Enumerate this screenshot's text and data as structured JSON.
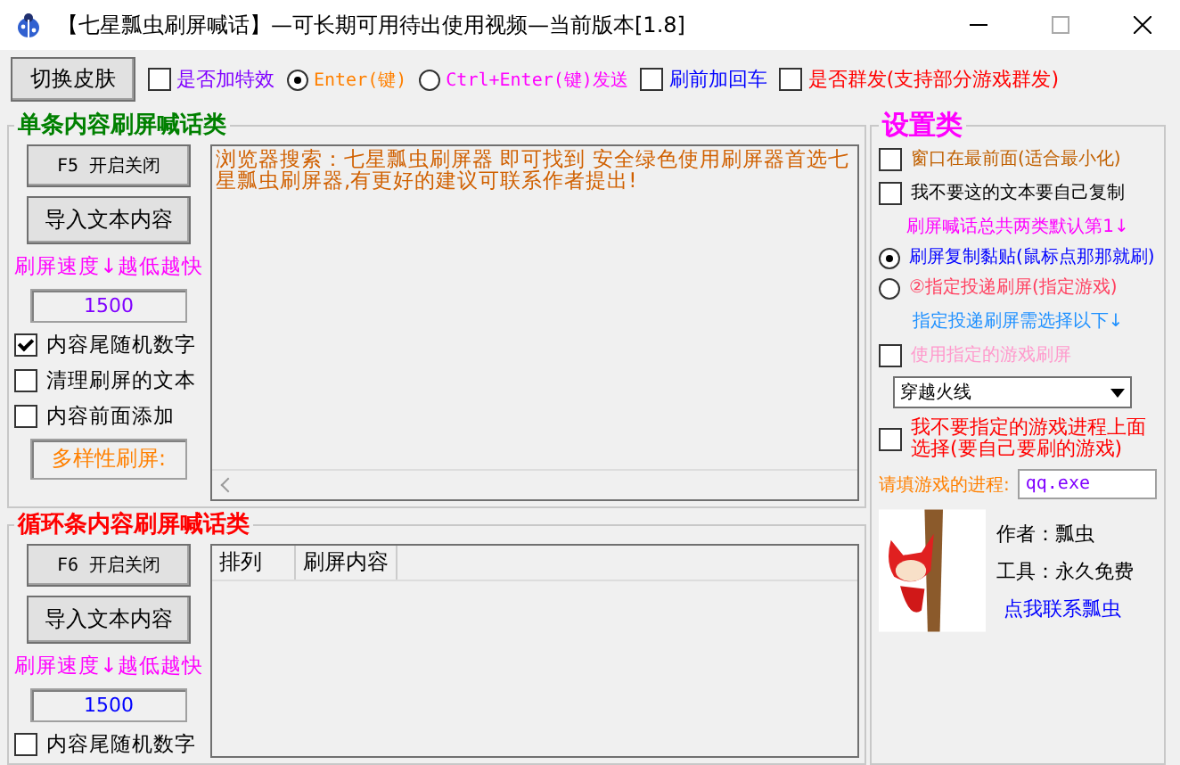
{
  "window": {
    "title": "【七星瓢虫刷屏喊话】—可长期可用待出使用视频—当前版本[1.8]"
  },
  "toolbar": {
    "skin_button": "切换皮肤",
    "options": [
      {
        "kind": "checkbox",
        "label": "是否加特效",
        "checked": false,
        "color": "#8000ff"
      },
      {
        "kind": "radio",
        "label": "Enter(键)",
        "selected": true,
        "color": "#ff8000"
      },
      {
        "kind": "radio",
        "label": "Ctrl+Enter(键)发送",
        "selected": false,
        "color": "#ff00ff"
      },
      {
        "kind": "checkbox",
        "label": "刷前加回车",
        "checked": false,
        "color": "#0000ff"
      },
      {
        "kind": "checkbox",
        "label": "是否群发(支持部分游戏群发)",
        "checked": false,
        "color": "#ff0000"
      }
    ]
  },
  "single_group": {
    "title": "单条内容刷屏喊话类",
    "buttons": [
      "F5 开启关闭",
      "导入文本内容"
    ],
    "speed_label": "刷屏速度↓越低越快",
    "speed_value": "1500",
    "checks": [
      {
        "label": "内容尾随机数字",
        "checked": true
      },
      {
        "label": "清理刷屏的文本",
        "checked": false
      },
      {
        "label": "内容前面添加",
        "checked": false
      }
    ],
    "variety_label": "多样性刷屏:",
    "message": "浏览器搜索：七星瓢虫刷屏器 即可找到 安全绿色使用刷屏器首选七星瓢虫刷屏器,有更好的建议可联系作者提出!"
  },
  "loop_group": {
    "title": "循环条内容刷屏喊话类",
    "buttons": [
      "F6 开启关闭",
      "导入文本内容"
    ],
    "speed_label": "刷屏速度↓越低越快",
    "speed_value": "1500",
    "checks": [
      {
        "label": "内容尾随机数字",
        "checked": false
      }
    ],
    "table": {
      "columns": [
        "排列",
        "刷屏内容"
      ]
    }
  },
  "settings": {
    "title": "设置类",
    "checks": [
      {
        "label": "窗口在最前面(适合最小化)",
        "checked": false,
        "color": "#c06000"
      },
      {
        "label": "我不要这的文本要自己复制",
        "checked": false,
        "color": "#000000"
      }
    ],
    "mode_note": "刷屏喊话总共两类默认第1↓",
    "modes": [
      {
        "label": "刷屏复制黏贴(鼠标点那那就刷)",
        "selected": true,
        "color": "#0000ff"
      },
      {
        "label": "②指定投递刷屏(指定游戏)",
        "selected": false,
        "color": "#ff4060"
      }
    ],
    "target_note": "指定投递刷屏需选择以下↓",
    "game_check": {
      "label": "使用指定的游戏刷屏",
      "checked": false,
      "disabled": true
    },
    "game_select": "穿越火线",
    "process_check": {
      "label": "我不要指定的游戏进程上面选择(要自己要刷的游戏)",
      "checked": false
    },
    "process_label": "请填游戏的进程:",
    "process_value": "qq.exe",
    "author": "作者：瓢虫",
    "tool": "工具：永久免费",
    "contact": "点我联系瓢虫"
  }
}
